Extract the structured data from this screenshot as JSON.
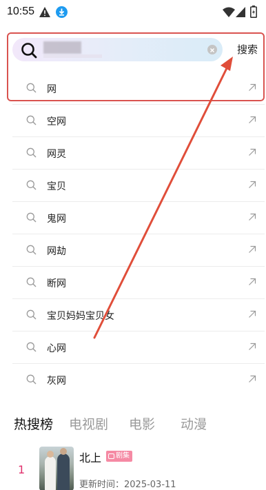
{
  "status_bar": {
    "time": "10:55",
    "icons": [
      "warning-icon",
      "download-icon",
      "wifi-icon",
      "signal-icon",
      "battery-icon"
    ]
  },
  "search": {
    "placeholder": "",
    "value": "",
    "button_label": "搜索",
    "accent_color": "#d9534f"
  },
  "suggestions": [
    {
      "text": "网"
    },
    {
      "text": "空网"
    },
    {
      "text": "网灵"
    },
    {
      "text": "宝贝"
    },
    {
      "text": "鬼网"
    },
    {
      "text": "网劫"
    },
    {
      "text": "断网"
    },
    {
      "text": "宝贝妈妈宝贝女"
    },
    {
      "text": "心网"
    },
    {
      "text": "灰网"
    }
  ],
  "tabs": [
    {
      "label": "热搜榜",
      "active": true
    },
    {
      "label": "电视剧",
      "active": false
    },
    {
      "label": "电影",
      "active": false
    },
    {
      "label": "动漫",
      "active": false
    }
  ],
  "hot_list": [
    {
      "rank": "1",
      "title": "北上",
      "badge": "剧集",
      "update_label": "更新时间：",
      "update_time": "2025-03-11"
    }
  ],
  "colors": {
    "rank_color": "#e0306c",
    "badge_color": "#f58aa4",
    "annotation_color": "#e04e3a"
  }
}
